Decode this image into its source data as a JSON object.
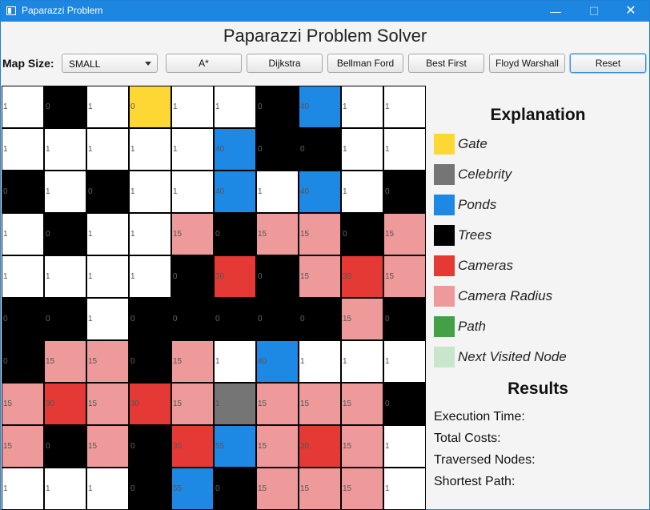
{
  "window": {
    "title": "Paparazzi Problem",
    "controls": {
      "minimize": "—",
      "maximize": "☐",
      "close": "✕"
    }
  },
  "app_title": "Paparazzi Problem Solver",
  "toolbar": {
    "map_size_label": "Map Size:",
    "map_size_value": "SMALL",
    "buttons": [
      "A*",
      "Dijkstra",
      "Bellman Ford",
      "Best First",
      "Floyd Warshall",
      "Reset"
    ]
  },
  "colors": {
    "gate": "#fdd835",
    "celebrity": "#757575",
    "pond": "#1e88e5",
    "tree": "#000000",
    "camera": "#e53935",
    "radius": "#ef9a9a",
    "path": "#43a047",
    "next": "#c8e6c9",
    "empty": "#ffffff"
  },
  "grid": {
    "types": [
      [
        "E",
        "T",
        "E",
        "G",
        "E",
        "E",
        "T",
        "P",
        "E",
        "E"
      ],
      [
        "E",
        "E",
        "E",
        "E",
        "E",
        "P",
        "T",
        "T",
        "E",
        "E"
      ],
      [
        "T",
        "E",
        "T",
        "E",
        "E",
        "P",
        "E",
        "P",
        "E",
        "T"
      ],
      [
        "E",
        "T",
        "E",
        "E",
        "R",
        "T",
        "R",
        "R",
        "T",
        "R"
      ],
      [
        "E",
        "E",
        "E",
        "E",
        "T",
        "C",
        "T",
        "R",
        "C",
        "R"
      ],
      [
        "T",
        "T",
        "E",
        "T",
        "T",
        "T",
        "T",
        "T",
        "R",
        "T"
      ],
      [
        "T",
        "R",
        "R",
        "T",
        "R",
        "E",
        "P",
        "E",
        "E",
        "E"
      ],
      [
        "R",
        "C",
        "R",
        "C",
        "R",
        "X",
        "R",
        "R",
        "R",
        "T"
      ],
      [
        "R",
        "T",
        "R",
        "T",
        "C",
        "P",
        "R",
        "C",
        "R",
        "E"
      ],
      [
        "E",
        "E",
        "E",
        "T",
        "P",
        "T",
        "R",
        "R",
        "R",
        "E"
      ]
    ],
    "costs": [
      [
        "1",
        "0",
        "1",
        "0",
        "1",
        "1",
        "0",
        "40",
        "1",
        "1"
      ],
      [
        "1",
        "1",
        "1",
        "1",
        "1",
        "40",
        "0",
        "0",
        "1",
        "1"
      ],
      [
        "0",
        "1",
        "0",
        "1",
        "1",
        "40",
        "1",
        "40",
        "1",
        "0"
      ],
      [
        "1",
        "0",
        "1",
        "1",
        "15",
        "0",
        "15",
        "15",
        "0",
        "15"
      ],
      [
        "1",
        "1",
        "1",
        "1",
        "0",
        "30",
        "0",
        "15",
        "30",
        "15"
      ],
      [
        "0",
        "0",
        "1",
        "0",
        "0",
        "0",
        "0",
        "0",
        "15",
        "0"
      ],
      [
        "0",
        "15",
        "15",
        "0",
        "15",
        "1",
        "40",
        "1",
        "1",
        "1"
      ],
      [
        "15",
        "30",
        "15",
        "30",
        "15",
        "1",
        "15",
        "15",
        "15",
        "0"
      ],
      [
        "15",
        "0",
        "15",
        "0",
        "30",
        "55",
        "15",
        "30",
        "15",
        "1"
      ],
      [
        "1",
        "1",
        "1",
        "0",
        "55",
        "0",
        "15",
        "15",
        "15",
        "1"
      ]
    ]
  },
  "legend": {
    "title": "Explanation",
    "items": [
      {
        "label": "Gate",
        "color": "#fdd835"
      },
      {
        "label": "Celebrity",
        "color": "#757575"
      },
      {
        "label": "Ponds",
        "color": "#1e88e5"
      },
      {
        "label": "Trees",
        "color": "#000000"
      },
      {
        "label": "Cameras",
        "color": "#e53935"
      },
      {
        "label": "Camera Radius",
        "color": "#ef9a9a"
      },
      {
        "label": "Path",
        "color": "#43a047"
      },
      {
        "label": "Next Visited Node",
        "color": "#c8e6c9"
      }
    ]
  },
  "results": {
    "title": "Results",
    "lines": [
      "Execution Time:",
      "Total Costs:",
      "Traversed Nodes:",
      "Shortest Path:"
    ]
  }
}
